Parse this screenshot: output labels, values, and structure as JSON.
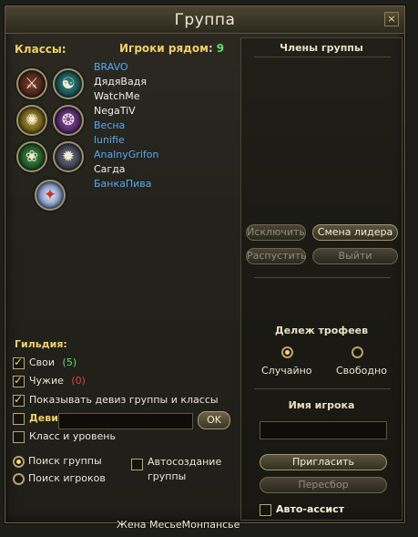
{
  "window": {
    "title": "Группа",
    "close_label": "×"
  },
  "labels": {
    "classes": "Классы:",
    "nearby": "Игроки рядом:",
    "guild": "Гильдия:"
  },
  "nearby_count": "9",
  "nearby_players": [
    {
      "name": "BRAVO",
      "color": "blue"
    },
    {
      "name": "ДядяВадя",
      "color": "white"
    },
    {
      "name": "WatchMe",
      "color": "white"
    },
    {
      "name": "NegaTiV",
      "color": "white"
    },
    {
      "name": "Весна",
      "color": "blue"
    },
    {
      "name": "lunifie",
      "color": "blue"
    },
    {
      "name": "AnalnyGrifon",
      "color": "blue"
    },
    {
      "name": "Сагда",
      "color": "white"
    },
    {
      "name": "БанкаПива",
      "color": "blue"
    }
  ],
  "class_icons": [
    {
      "name": "class-warrior-icon",
      "glyph": "⚔"
    },
    {
      "name": "class-mage-icon",
      "glyph": "☯"
    },
    {
      "name": "class-healer-icon",
      "glyph": "✺"
    },
    {
      "name": "class-psionic-icon",
      "glyph": "❂"
    },
    {
      "name": "class-ranger-icon",
      "glyph": "❀"
    },
    {
      "name": "class-necro-icon",
      "glyph": "✹"
    },
    {
      "name": "class-summoner-icon",
      "glyph": "✦"
    }
  ],
  "guild": {
    "own_label": "Свои",
    "own_count": "(5)",
    "others_label": "Чужие",
    "others_count": "(0)",
    "show_motto_label": "Показывать девиз группы и классы",
    "motto_label": "Девиз",
    "motto_value": "",
    "ok_label": "OK",
    "class_level_label": "Класс и уровень"
  },
  "search": {
    "group_search_label": "Поиск группы",
    "player_search_label": "Поиск игроков",
    "autocreate_label_1": "Автосоздание",
    "autocreate_label_2": "группы"
  },
  "right": {
    "members_title": "Члены группы",
    "kick_label": "Исключить",
    "change_leader_label": "Смена лидера",
    "disband_label": "Распустить",
    "leave_label": "Выйти",
    "loot_title": "Дележ трофеев",
    "random_label": "Случайно",
    "free_label": "Свободно",
    "player_name_title": "Имя игрока",
    "player_name_value": "",
    "invite_label": "Пригласить",
    "reroll_label": "Пересбор",
    "auto_assist_label": "Авто-ассист"
  },
  "bottom_player_name": "Жена МесьеМонпансье",
  "colors": {
    "gold": "#f0cf66",
    "blue_name": "#55a9f0",
    "count_green": "#5ee06a",
    "count_red": "#e04545"
  }
}
